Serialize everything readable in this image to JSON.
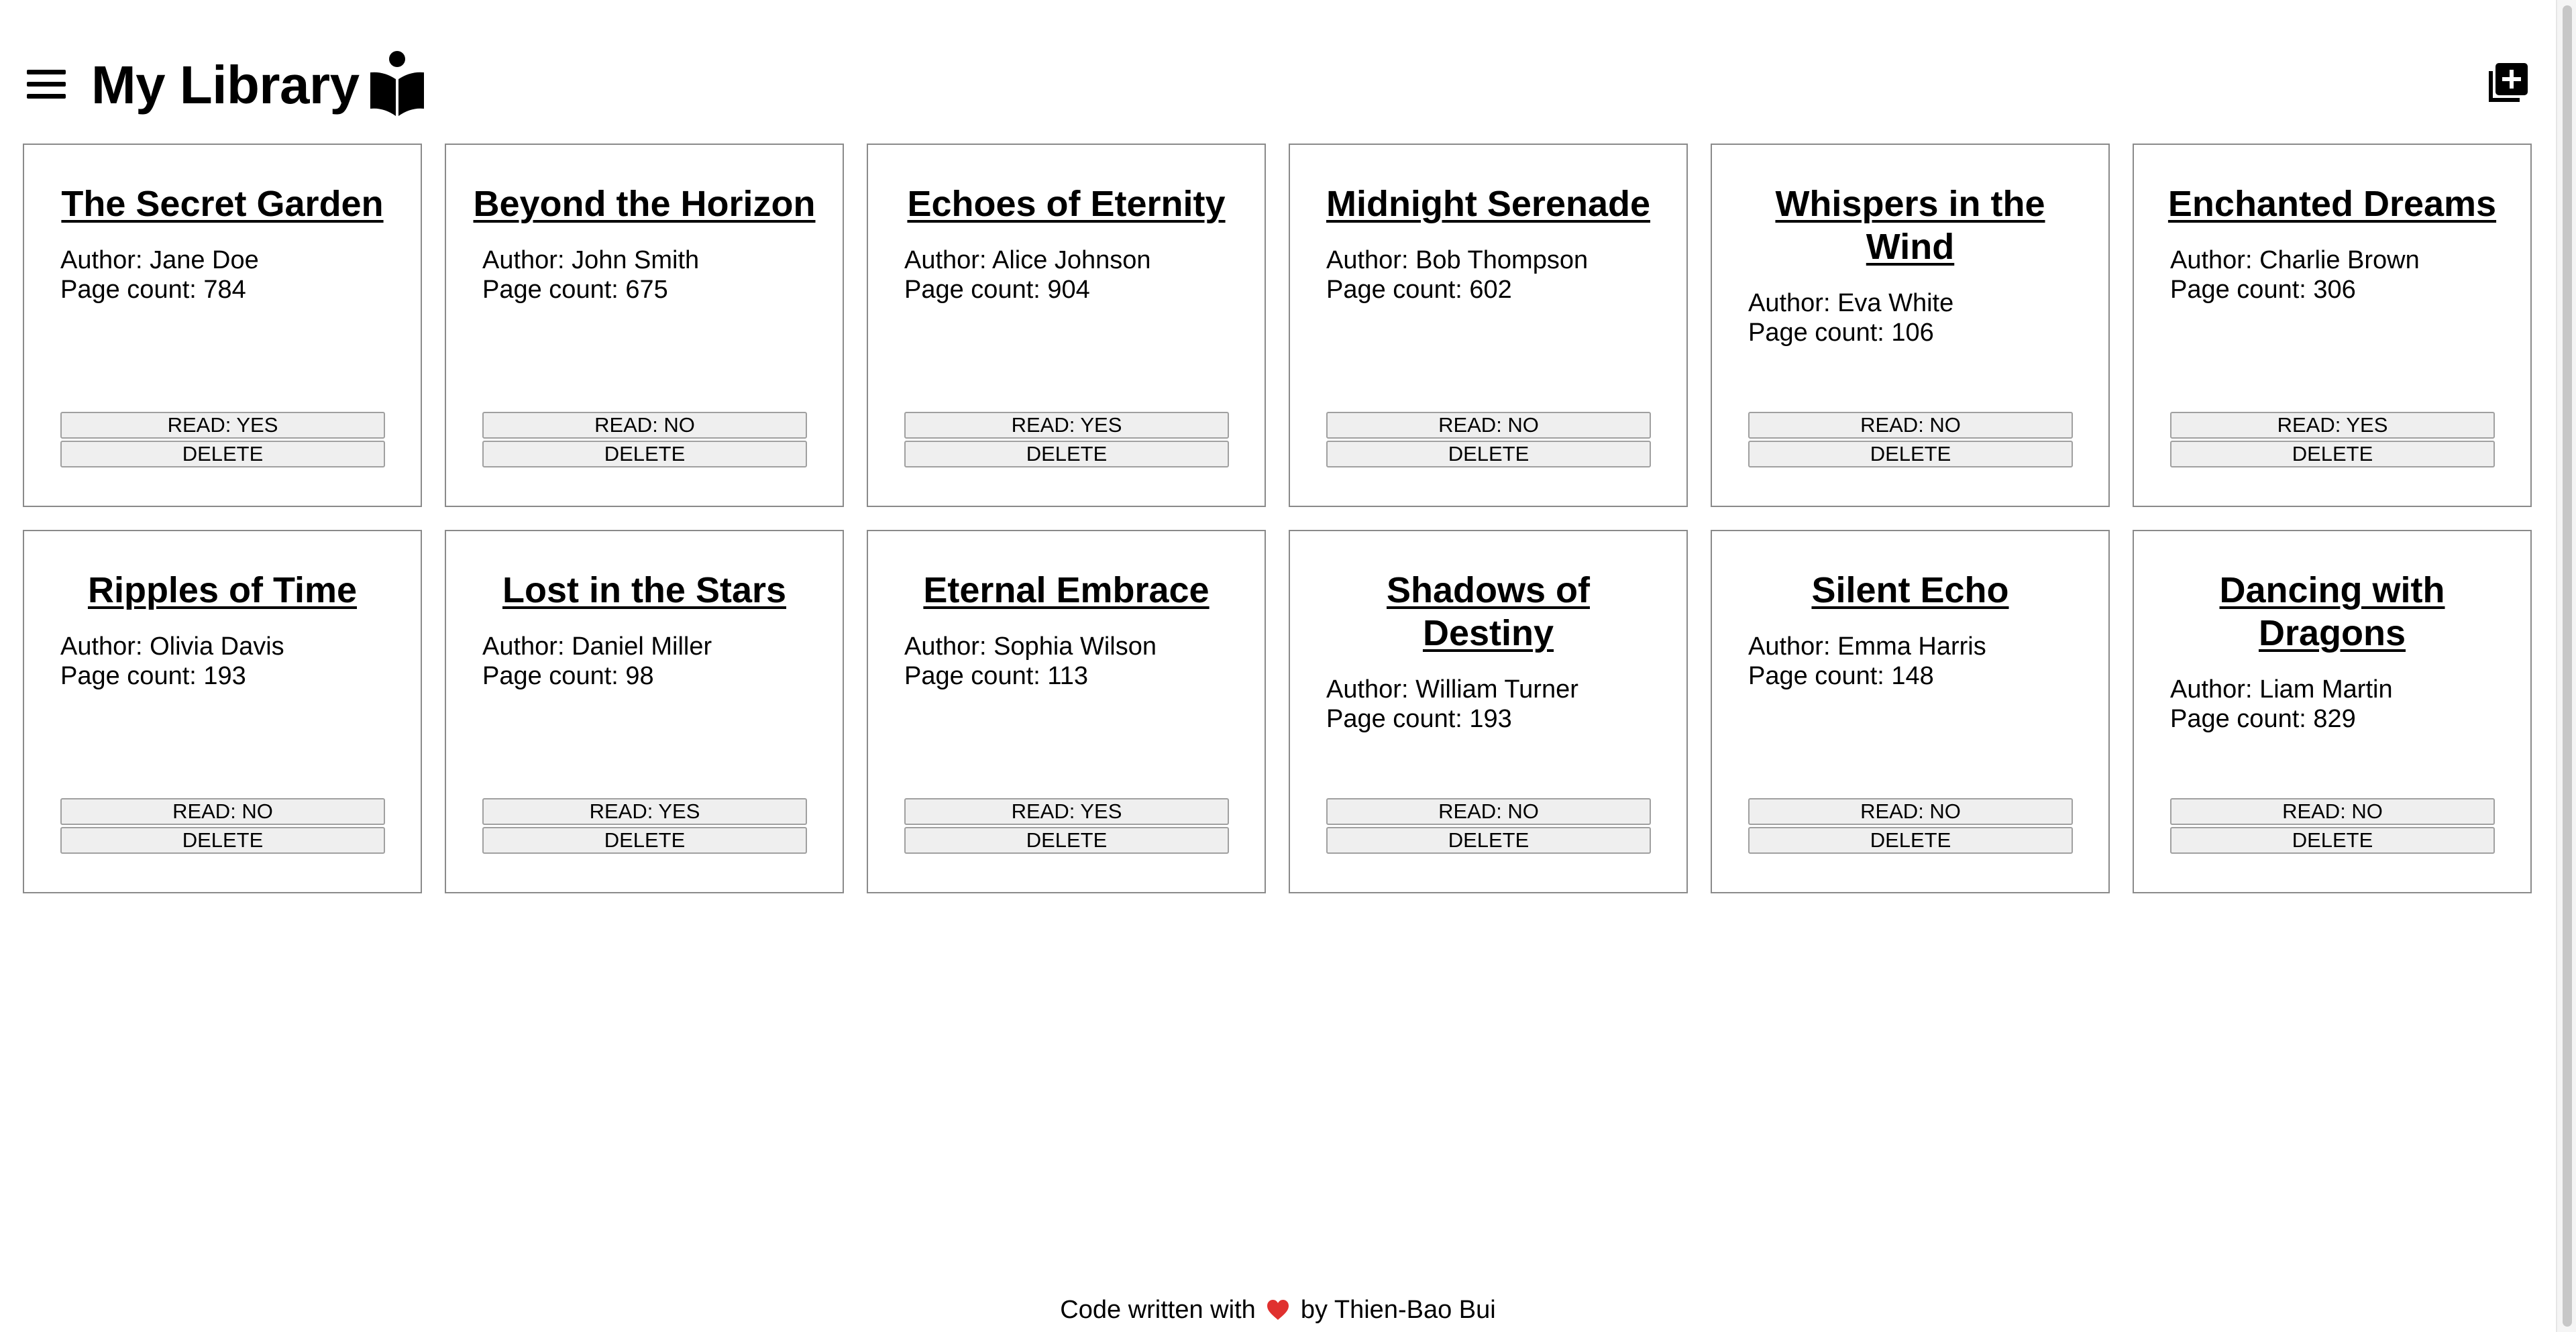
{
  "header": {
    "title": "My Library",
    "menu_icon": "hamburger-menu-icon",
    "logo_icon": "book-reader-icon",
    "add_icon": "add-book-icon"
  },
  "books": [
    {
      "title": "The Secret Garden",
      "author": "Author: Jane Doe",
      "pages": "Page count: 784",
      "read_label": "READ: YES",
      "delete_label": "DELETE"
    },
    {
      "title": "Beyond the Horizon",
      "author": "Author: John Smith",
      "pages": "Page count: 675",
      "read_label": "READ: NO",
      "delete_label": "DELETE"
    },
    {
      "title": "Echoes of Eternity",
      "author": "Author: Alice Johnson",
      "pages": "Page count: 904",
      "read_label": "READ: YES",
      "delete_label": "DELETE"
    },
    {
      "title": "Midnight Serenade",
      "author": "Author: Bob Thompson",
      "pages": "Page count: 602",
      "read_label": "READ: NO",
      "delete_label": "DELETE"
    },
    {
      "title": "Whispers in the Wind",
      "author": "Author: Eva White",
      "pages": "Page count: 106",
      "read_label": "READ: NO",
      "delete_label": "DELETE"
    },
    {
      "title": "Enchanted Dreams",
      "author": "Author: Charlie Brown",
      "pages": "Page count: 306",
      "read_label": "READ: YES",
      "delete_label": "DELETE"
    },
    {
      "title": "Ripples of Time",
      "author": "Author: Olivia Davis",
      "pages": "Page count: 193",
      "read_label": "READ: NO",
      "delete_label": "DELETE"
    },
    {
      "title": "Lost in the Stars",
      "author": "Author: Daniel Miller",
      "pages": "Page count: 98",
      "read_label": "READ: YES",
      "delete_label": "DELETE"
    },
    {
      "title": "Eternal Embrace",
      "author": "Author: Sophia Wilson",
      "pages": "Page count: 113",
      "read_label": "READ: YES",
      "delete_label": "DELETE"
    },
    {
      "title": "Shadows of Destiny",
      "author": "Author: William Turner",
      "pages": "Page count: 193",
      "read_label": "READ: NO",
      "delete_label": "DELETE"
    },
    {
      "title": "Silent Echo",
      "author": "Author: Emma Harris",
      "pages": "Page count: 148",
      "read_label": "READ: NO",
      "delete_label": "DELETE"
    },
    {
      "title": "Dancing with Dragons",
      "author": "Author: Liam Martin",
      "pages": "Page count: 829",
      "read_label": "READ: NO",
      "delete_label": "DELETE"
    }
  ],
  "footer": {
    "before": "Code written with",
    "heart_icon": "heart-icon",
    "after": "by Thien-Bao Bui"
  },
  "colors": {
    "heart": "#e0312f",
    "card_border": "#8a8a8a",
    "button_bg": "#efefef"
  }
}
